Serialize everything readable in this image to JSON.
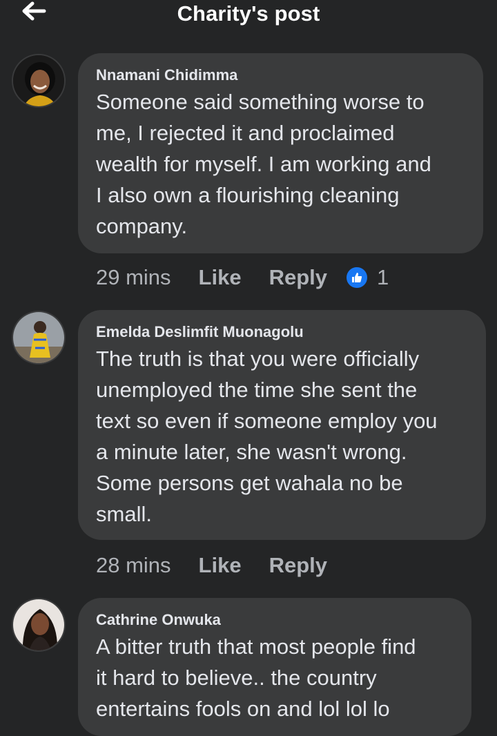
{
  "header": {
    "title": "Charity's post",
    "back_icon": "arrow-left-icon"
  },
  "comments": [
    {
      "author": "Nnamani Chidimma",
      "text": "Someone said something worse to me, I rejected it and proclaimed wealth for myself. I am working and I also own a flourishing cleaning company.",
      "lines": [
        "Someone said something worse to",
        "me, I rejected it and proclaimed",
        "wealth for myself. I am working and",
        "I also own a flourishing cleaning",
        "company."
      ],
      "time": "29 mins",
      "like_label": "Like",
      "reply_label": "Reply",
      "reaction_count": "1",
      "reaction_icon": "like-reaction-icon"
    },
    {
      "author": "Emelda Deslimfit Muonagolu",
      "lines": [
        "The truth is that you were officially",
        "unemployed the time she sent the",
        "text so even if someone employ you",
        "a minute later, she wasn't wrong.",
        "Some persons get wahala no be",
        "small."
      ],
      "time": "28 mins",
      "like_label": "Like",
      "reply_label": "Reply"
    },
    {
      "author": "Cathrine Onwuka",
      "lines": [
        "A bitter truth that most people find",
        "it hard to believe.. the country",
        "entertains fools on and lol lol lo"
      ]
    }
  ],
  "colors": {
    "background": "#242526",
    "bubble": "#3a3b3c",
    "text": "#e4e6eb",
    "meta": "#b0b3b8",
    "like_blue": "#1877f2"
  }
}
